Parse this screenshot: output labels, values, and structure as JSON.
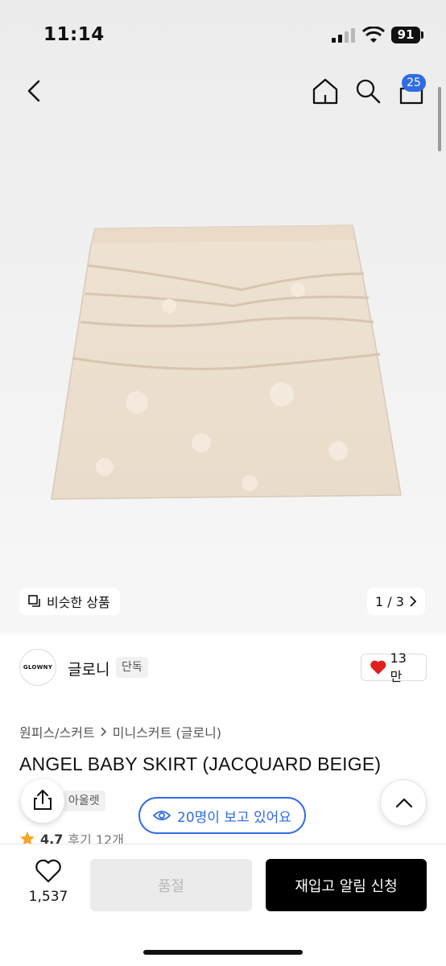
{
  "status": {
    "time": "11:14",
    "battery": "91"
  },
  "nav": {
    "cart_count": "25"
  },
  "gallery": {
    "similar_label": "비슷한 상품",
    "counter": "1 / 3"
  },
  "brand": {
    "logo_text": "GLOWNY",
    "name": "글로니",
    "tag": "단독",
    "likes": "13만",
    "heart_color": "#e02020"
  },
  "breadcrumb": {
    "category": "원피스/스커트",
    "subcategory": "미니스커트 (글로니)"
  },
  "product": {
    "title": "ANGEL BABY SKIRT (JACQUARD BEIGE)",
    "tag": "아울렛"
  },
  "viewers": {
    "text": "20명이 보고 있어요",
    "color": "#2f6be5"
  },
  "rating": {
    "score": "4.7",
    "reviews": "후기 12개",
    "star_color": "#f5a623"
  },
  "bottom": {
    "wish_count": "1,537",
    "soldout_label": "품절",
    "restock_label": "재입고 알림 신청"
  }
}
